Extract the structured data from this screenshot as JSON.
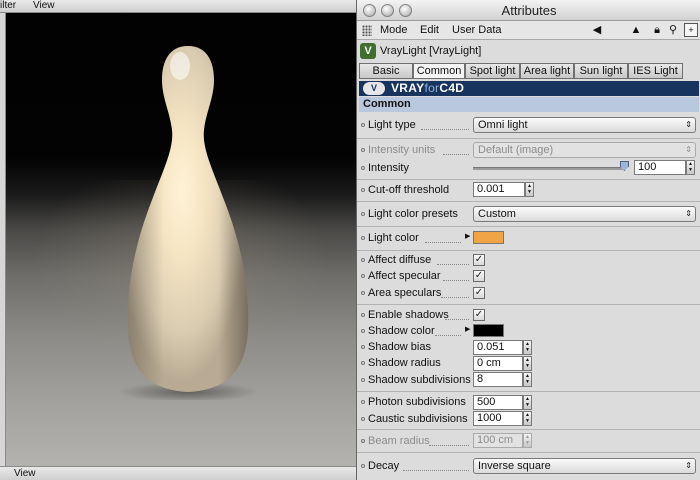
{
  "viewport": {
    "menu_partial": "ilter",
    "menu_view": "View",
    "bottom_view": "View"
  },
  "attributes": {
    "window_title": "Attributes",
    "menu": {
      "mode": "Mode",
      "edit": "Edit",
      "user_data": "User Data"
    },
    "object_name": "VrayLight [VrayLight]",
    "tabs": [
      "Basic",
      "Common",
      "Spot light",
      "Area light",
      "Sun light",
      "IES Light"
    ],
    "active_tab": "Common",
    "banner": {
      "left": "VRAY",
      "middle": "for",
      "right": "C4D"
    },
    "section": "Common",
    "fields": {
      "light_type": {
        "label": "Light type",
        "value": "Omni light"
      },
      "intensity_units": {
        "label": "Intensity units",
        "value": "Default (image)"
      },
      "intensity": {
        "label": "Intensity",
        "value": "100"
      },
      "cutoff_threshold": {
        "label": "Cut-off threshold",
        "value": "0.001"
      },
      "light_color_presets": {
        "label": "Light color presets",
        "value": "Custom"
      },
      "light_color": {
        "label": "Light color",
        "color": "#f0a445"
      },
      "affect_diffuse": {
        "label": "Affect diffuse",
        "checked": true
      },
      "affect_specular": {
        "label": "Affect specular",
        "checked": true
      },
      "area_speculars": {
        "label": "Area speculars",
        "checked": true
      },
      "enable_shadows": {
        "label": "Enable shadows",
        "checked": true
      },
      "shadow_color": {
        "label": "Shadow color",
        "color": "#000000"
      },
      "shadow_bias": {
        "label": "Shadow bias",
        "value": "0.051 cm"
      },
      "shadow_radius": {
        "label": "Shadow radius",
        "value": "0 cm"
      },
      "shadow_subdivisions": {
        "label": "Shadow subdivisions",
        "value": "8"
      },
      "photon_subdivisions": {
        "label": "Photon subdivisions",
        "value": "500"
      },
      "caustic_subdivisions": {
        "label": "Caustic subdivisions",
        "value": "1000"
      },
      "beam_radius": {
        "label": "Beam radius",
        "value": "100 cm"
      },
      "decay": {
        "label": "Decay",
        "value": "Inverse square"
      }
    },
    "check_glyph": "✓",
    "dropdown_arrow": "⇕",
    "icons": [
      "grip-icon",
      "back-arrow-icon",
      "up-arrow-icon",
      "lock-icon",
      "new-window-icon",
      "vray-object-icon"
    ]
  }
}
